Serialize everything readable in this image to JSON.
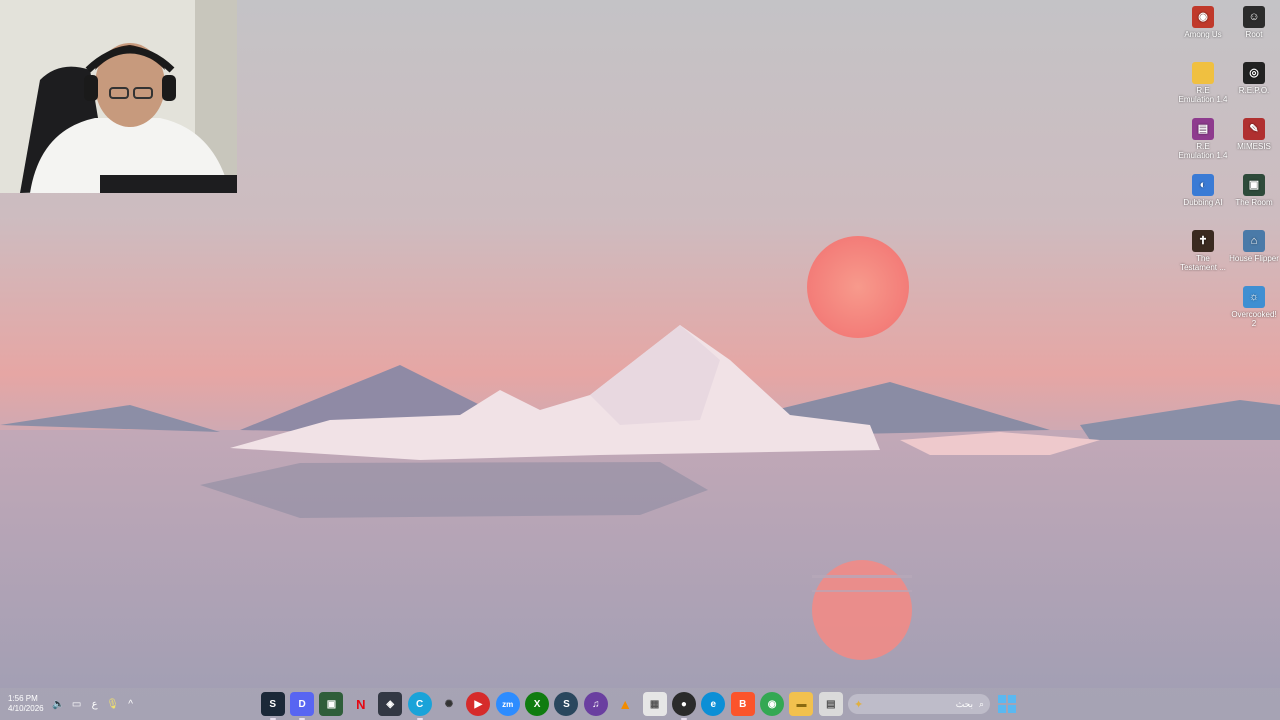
{
  "desktop_icons": [
    {
      "label": "Among Us",
      "icon": "among-us-icon",
      "color": "#c0392b"
    },
    {
      "label": "Root",
      "icon": "root-icon",
      "color": "#2c2c2c"
    },
    {
      "label": "R.E Emulation 1.4",
      "icon": "folder-icon",
      "color": "#f0c040"
    },
    {
      "label": "R.E.P.O.",
      "icon": "repo-icon",
      "color": "#222222"
    },
    {
      "label": "R.E Emulation 1.4",
      "icon": "winrar-icon",
      "color": "#8e3b8e"
    },
    {
      "label": "MIMESIS",
      "icon": "mimesis-icon",
      "color": "#b03030"
    },
    {
      "label": "Dubbing AI",
      "icon": "dubbing-ai-icon",
      "color": "#3a7bd5"
    },
    {
      "label": "The Room",
      "icon": "the-room-icon",
      "color": "#2e4a3a"
    },
    {
      "label": "The Testament ...",
      "icon": "testament-icon",
      "color": "#3a2a20"
    },
    {
      "label": "House Flipper",
      "icon": "house-flipper-icon",
      "color": "#4a7aa8"
    },
    {
      "label": "Overcooked! 2",
      "icon": "overcooked-icon",
      "color": "#3f8fd2"
    }
  ],
  "taskbar": {
    "time": "1:56 PM",
    "date": "4/10/2026",
    "language": "ع",
    "search_placeholder": "بحث",
    "apps": [
      {
        "name": "steam-icon",
        "glyph": "S",
        "color": "#1b2838"
      },
      {
        "name": "discord-icon",
        "glyph": "D",
        "color": "#5865f2"
      },
      {
        "name": "app-green-icon",
        "glyph": "▣",
        "color": "#2f5e3a"
      },
      {
        "name": "netflix-icon",
        "glyph": "N",
        "color": "#e50914"
      },
      {
        "name": "davinci-resolve-icon",
        "glyph": "◈",
        "color": "#333844"
      },
      {
        "name": "chatgpt-circle-icon",
        "glyph": "C",
        "color": "#1aa3d9"
      },
      {
        "name": "steelseries-icon",
        "glyph": "✺",
        "color": "#444"
      },
      {
        "name": "youtube-music-icon",
        "glyph": "▶",
        "color": "#d62b2b"
      },
      {
        "name": "zoom-icon",
        "glyph": "zm",
        "color": "#2d8cff"
      },
      {
        "name": "xbox-icon",
        "glyph": "X",
        "color": "#107c10"
      },
      {
        "name": "steam-2-icon",
        "glyph": "S",
        "color": "#2a475e"
      },
      {
        "name": "headset-app-icon",
        "glyph": "♫",
        "color": "#6a3fa0"
      },
      {
        "name": "vlc-icon",
        "glyph": "▲",
        "color": "#f28c00"
      },
      {
        "name": "microsoft-store-icon",
        "glyph": "▦",
        "color": "#e6e6e6"
      },
      {
        "name": "obs-icon",
        "glyph": "●",
        "color": "#2b2b2b"
      },
      {
        "name": "edge-icon",
        "glyph": "e",
        "color": "#0c8fd6"
      },
      {
        "name": "brave-icon",
        "glyph": "B",
        "color": "#fb542b"
      },
      {
        "name": "chrome-icon",
        "glyph": "◉",
        "color": "#34a853"
      },
      {
        "name": "file-explorer-icon",
        "glyph": "▬",
        "color": "#f2c14e"
      },
      {
        "name": "notepad-icon",
        "glyph": "▤",
        "color": "#dadada"
      }
    ]
  }
}
